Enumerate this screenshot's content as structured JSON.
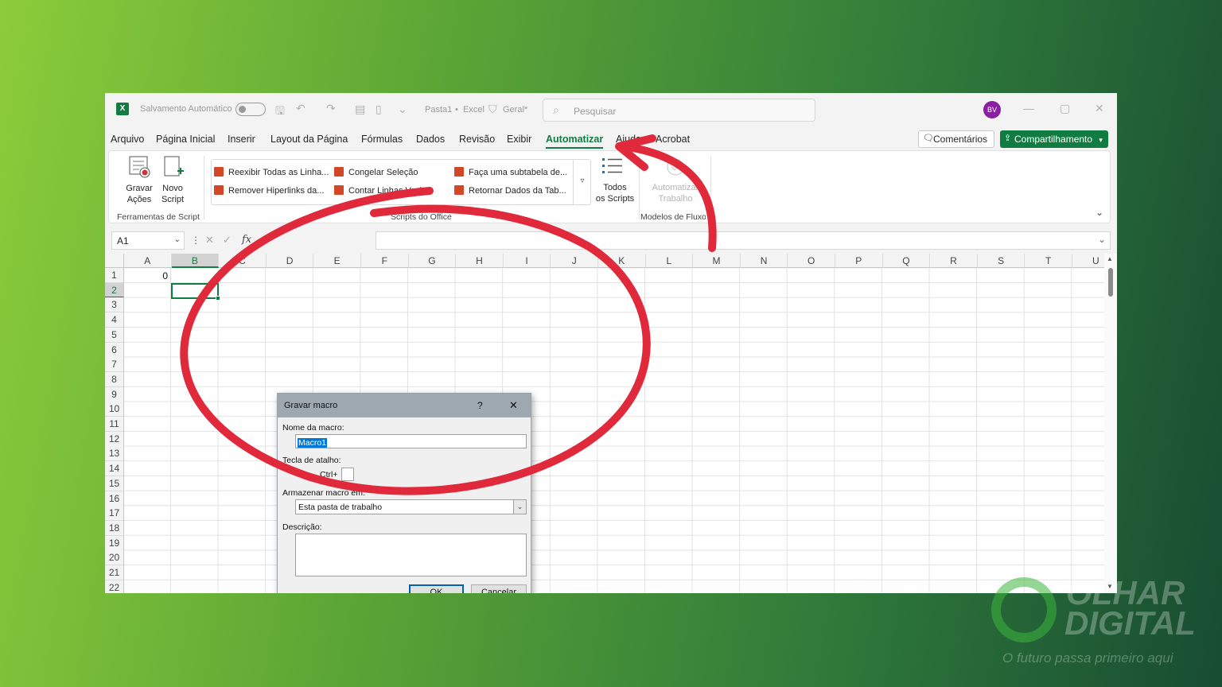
{
  "titlebar": {
    "autosave_label": "Salvamento Automático",
    "file_name": "Pasta1",
    "app_name": "Excel",
    "sensitivity": "Geral*",
    "search_placeholder": "Pesquisar",
    "avatar_initials": "BV"
  },
  "menu": {
    "items": [
      "Arquivo",
      "Página Inicial",
      "Inserir",
      "Layout da Página",
      "Fórmulas",
      "Dados",
      "Revisão",
      "Exibir",
      "Automatizar",
      "Ajuda",
      "Acrobat"
    ],
    "active": "Automatizar",
    "comments_label": "Comentários",
    "share_label": "Compartilhamento"
  },
  "ribbon": {
    "record_label_1": "Gravar",
    "record_label_2": "Ações",
    "new_script_label_1": "Novo",
    "new_script_label_2": "Script",
    "group_script_tools": "Ferramentas de Script",
    "scripts": [
      "Reexibir Todas as Linha...",
      "Remover Hiperlinks da...",
      "Congelar Seleção",
      "Contar Linhas Vazias",
      "Faça uma subtabela de...",
      "Retornar Dados da Tab..."
    ],
    "group_office_scripts": "Scripts do Office",
    "all_scripts_label_1": "Todos",
    "all_scripts_label_2": "os Scripts",
    "automate_label_1": "Automatizar",
    "automate_label_2": "Trabalho",
    "group_flow_templates": "Modelos de Fluxo"
  },
  "formula_bar": {
    "name_box": "A1",
    "fx": "fx"
  },
  "grid": {
    "columns": [
      "A",
      "B",
      "C",
      "D",
      "E",
      "F",
      "G",
      "H",
      "I",
      "J",
      "K",
      "L",
      "M",
      "N",
      "O",
      "P",
      "Q",
      "R",
      "S",
      "T",
      "U"
    ],
    "rows": [
      "1",
      "2",
      "3",
      "4",
      "5",
      "6",
      "7",
      "8",
      "9",
      "10",
      "11",
      "12",
      "13",
      "14",
      "15",
      "16",
      "17",
      "18",
      "19",
      "20",
      "21",
      "22"
    ],
    "cell_A1": "0"
  },
  "dialog": {
    "title": "Gravar macro",
    "help": "?",
    "close": "✕",
    "macro_name_label": "Nome da macro:",
    "macro_name_value": "Macro1",
    "shortcut_label": "Tecla de atalho:",
    "ctrl_label": "Ctrl+",
    "store_label": "Armazenar macro em:",
    "store_value": "Esta pasta de trabalho",
    "description_label": "Descrição:",
    "ok_label": "OK",
    "cancel_label": "Cancelar"
  },
  "watermark": {
    "line1": "OLHAR",
    "line2": "DIGITAL",
    "tagline": "O futuro passa primeiro aqui"
  },
  "annotation_color": "#e0293a"
}
